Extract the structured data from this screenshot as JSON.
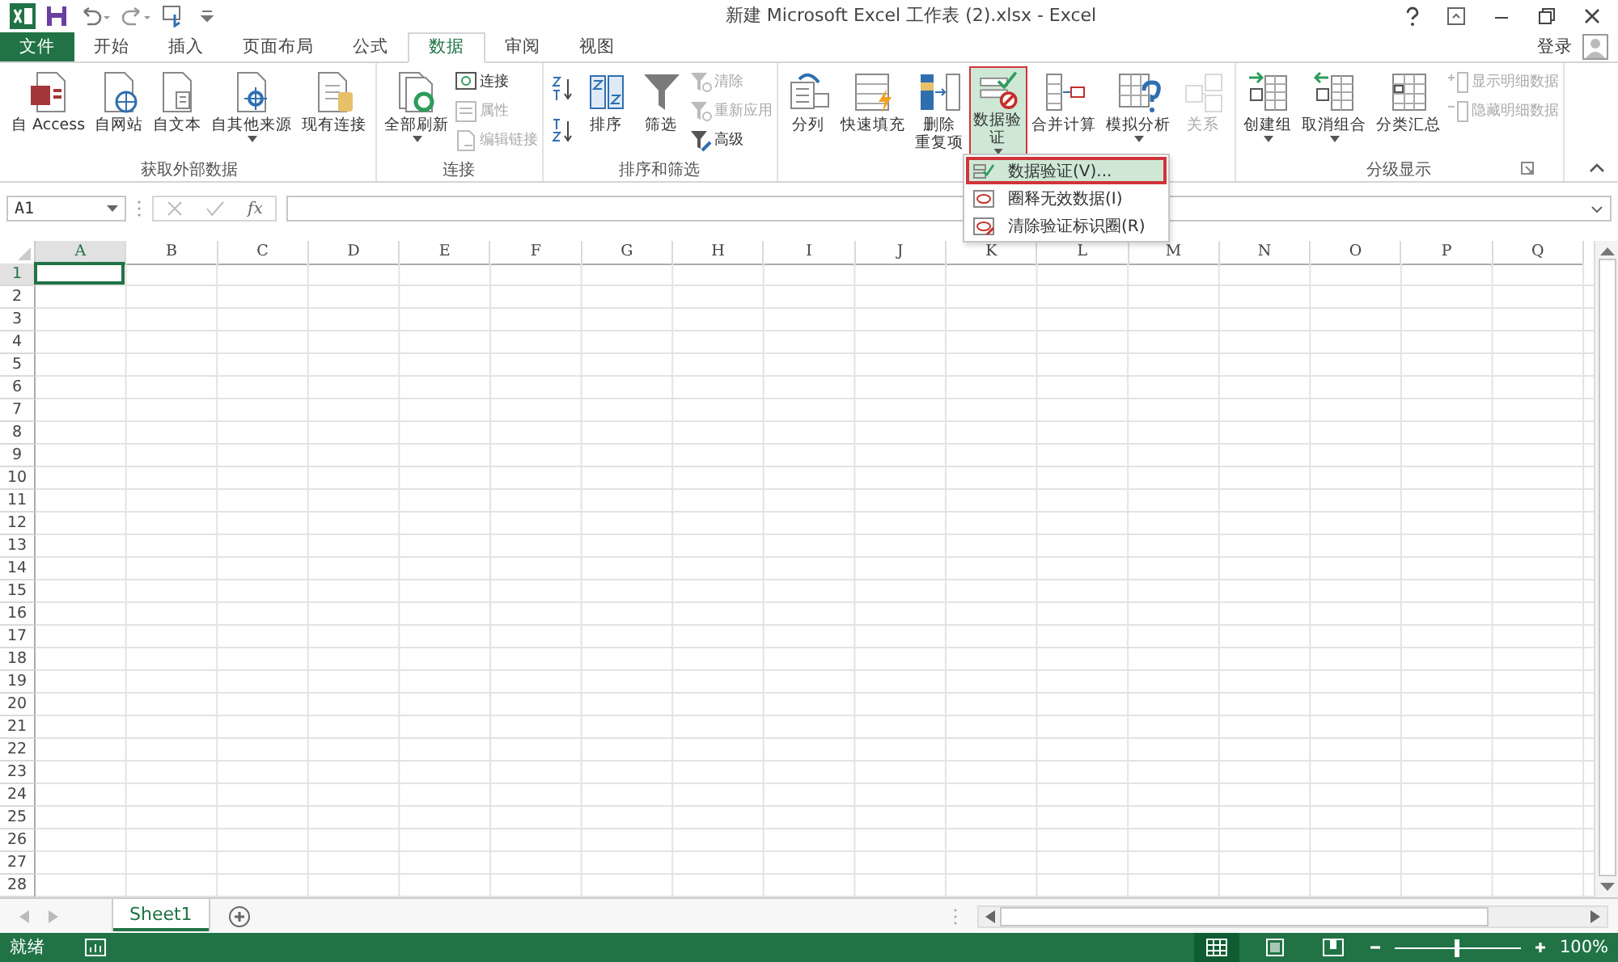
{
  "window": {
    "title": "新建 Microsoft Excel 工作表 (2).xlsx - Excel",
    "account": "登录"
  },
  "tabs": [
    {
      "label": "文件",
      "kind": "file",
      "selected": false
    },
    {
      "label": "开始",
      "kind": "tab",
      "selected": false
    },
    {
      "label": "插入",
      "kind": "tab",
      "selected": false
    },
    {
      "label": "页面布局",
      "kind": "tab",
      "selected": false
    },
    {
      "label": "公式",
      "kind": "tab",
      "selected": false
    },
    {
      "label": "数据",
      "kind": "tab",
      "selected": true
    },
    {
      "label": "审阅",
      "kind": "tab",
      "selected": false
    },
    {
      "label": "视图",
      "kind": "tab",
      "selected": false
    }
  ],
  "ribbon": {
    "groups": [
      {
        "label": "获取外部数据",
        "items": [
          {
            "kind": "large",
            "label": "自 Access",
            "dropdown": false,
            "selected": false,
            "disabled": false
          },
          {
            "kind": "large",
            "label": "自网站",
            "dropdown": false,
            "selected": false,
            "disabled": false
          },
          {
            "kind": "large",
            "label": "自文本",
            "dropdown": false,
            "selected": false,
            "disabled": false
          },
          {
            "kind": "large",
            "label": "自其他来源",
            "dropdown": true,
            "selected": false,
            "disabled": false
          },
          {
            "kind": "large",
            "label": "现有连接",
            "dropdown": false,
            "selected": false,
            "disabled": false
          }
        ]
      },
      {
        "label": "连接",
        "items": [
          {
            "kind": "large",
            "label": "全部刷新",
            "dropdown": true,
            "selected": false,
            "disabled": false
          },
          {
            "kind": "stack",
            "entries": [
              {
                "label": "连接",
                "disabled": false
              },
              {
                "label": "属性",
                "disabled": true
              },
              {
                "label": "编辑链接",
                "disabled": true
              }
            ]
          }
        ]
      },
      {
        "label": "排序和筛选",
        "items": [
          {
            "kind": "sort-pair"
          },
          {
            "kind": "large",
            "label": "排序",
            "dropdown": false,
            "selected": false,
            "disabled": false
          },
          {
            "kind": "large",
            "label": "筛选",
            "dropdown": false,
            "selected": false,
            "disabled": false
          },
          {
            "kind": "stack",
            "entries": [
              {
                "label": "清除",
                "disabled": true
              },
              {
                "label": "重新应用",
                "disabled": true
              },
              {
                "label": "高级",
                "disabled": false
              }
            ]
          }
        ]
      },
      {
        "items": [
          {
            "kind": "large",
            "label": "分列",
            "dropdown": false,
            "selected": false,
            "disabled": false
          },
          {
            "kind": "large",
            "label": "快速填充",
            "dropdown": false,
            "selected": false,
            "disabled": false
          },
          {
            "kind": "large",
            "lines": [
              "删除",
              "重复项"
            ],
            "dropdown": false,
            "selected": false,
            "disabled": false
          },
          {
            "kind": "large",
            "lines": [
              "数据验",
              "证"
            ],
            "dropdown": true,
            "selected": true,
            "disabled": false
          },
          {
            "kind": "large",
            "label": "合并计算",
            "dropdown": false,
            "selected": false,
            "disabled": false
          },
          {
            "kind": "large",
            "label": "模拟分析",
            "dropdown": true,
            "selected": false,
            "disabled": false
          },
          {
            "kind": "large",
            "label": "关系",
            "dropdown": false,
            "selected": false,
            "disabled": true
          }
        ]
      },
      {
        "label": "分级显示",
        "items": [
          {
            "kind": "large",
            "label": "创建组",
            "dropdown": true,
            "selected": false,
            "disabled": false
          },
          {
            "kind": "large",
            "label": "取消组合",
            "dropdown": true,
            "selected": false,
            "disabled": false
          },
          {
            "kind": "large",
            "label": "分类汇总",
            "dropdown": false,
            "selected": false,
            "disabled": false
          },
          {
            "kind": "stack",
            "entries": [
              {
                "label": "显示明细数据",
                "disabled": true
              },
              {
                "label": "隐藏明细数据",
                "disabled": true
              }
            ]
          }
        ]
      }
    ]
  },
  "menu": [
    {
      "label": "数据验证(V)...",
      "selected": true
    },
    {
      "label": "圈释无效数据(I)",
      "selected": false
    },
    {
      "label": "清除验证标识圈(R)",
      "selected": false
    }
  ],
  "formula_bar": {
    "name_box": "A1",
    "function_label": "fx"
  },
  "columns": [
    {
      "label": "A",
      "selected": true
    },
    {
      "label": "B",
      "selected": false
    },
    {
      "label": "C",
      "selected": false
    },
    {
      "label": "D",
      "selected": false
    },
    {
      "label": "E",
      "selected": false
    },
    {
      "label": "F",
      "selected": false
    },
    {
      "label": "G",
      "selected": false
    },
    {
      "label": "H",
      "selected": false
    },
    {
      "label": "I",
      "selected": false
    },
    {
      "label": "J",
      "selected": false
    },
    {
      "label": "K",
      "selected": false
    },
    {
      "label": "L",
      "selected": false
    },
    {
      "label": "M",
      "selected": false
    },
    {
      "label": "N",
      "selected": false
    },
    {
      "label": "O",
      "selected": false
    },
    {
      "label": "P",
      "selected": false
    },
    {
      "label": "Q",
      "selected": false
    }
  ],
  "rows": [
    {
      "label": "1",
      "selected": true
    },
    {
      "label": "2",
      "selected": false
    },
    {
      "label": "3",
      "selected": false
    },
    {
      "label": "4",
      "selected": false
    },
    {
      "label": "5",
      "selected": false
    },
    {
      "label": "6",
      "selected": false
    },
    {
      "label": "7",
      "selected": false
    },
    {
      "label": "8",
      "selected": false
    },
    {
      "label": "9",
      "selected": false
    },
    {
      "label": "10",
      "selected": false
    },
    {
      "label": "11",
      "selected": false
    },
    {
      "label": "12",
      "selected": false
    },
    {
      "label": "13",
      "selected": false
    },
    {
      "label": "14",
      "selected": false
    },
    {
      "label": "15",
      "selected": false
    },
    {
      "label": "16",
      "selected": false
    },
    {
      "label": "17",
      "selected": false
    },
    {
      "label": "18",
      "selected": false
    },
    {
      "label": "19",
      "selected": false
    },
    {
      "label": "20",
      "selected": false
    },
    {
      "label": "21",
      "selected": false
    },
    {
      "label": "22",
      "selected": false
    },
    {
      "label": "23",
      "selected": false
    },
    {
      "label": "24",
      "selected": false
    },
    {
      "label": "25",
      "selected": false
    },
    {
      "label": "26",
      "selected": false
    },
    {
      "label": "27",
      "selected": false
    },
    {
      "label": "28",
      "selected": false
    }
  ],
  "sheets": [
    {
      "label": "Sheet1",
      "selected": true
    }
  ],
  "status_bar": {
    "status": "就绪",
    "views": [
      {
        "selected": true
      },
      {
        "selected": false
      },
      {
        "selected": false
      }
    ],
    "zoom": {
      "level": 0.5,
      "reading": "100%"
    }
  }
}
